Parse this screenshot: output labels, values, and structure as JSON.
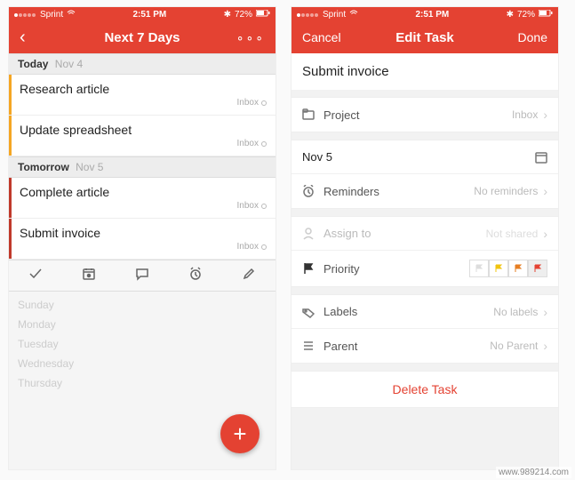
{
  "status": {
    "carrier": "Sprint",
    "time": "2:51 PM",
    "battery": "72%"
  },
  "left": {
    "title": "Next 7 Days",
    "sections": [
      {
        "label": "Today",
        "sub": "Nov 4",
        "tasks": [
          {
            "title": "Research article",
            "project": "Inbox",
            "color": "#f5a623"
          },
          {
            "title": "Update spreadsheet",
            "project": "Inbox",
            "color": "#f5a623"
          }
        ]
      },
      {
        "label": "Tomorrow",
        "sub": "Nov 5",
        "tasks": [
          {
            "title": "Complete article",
            "project": "Inbox",
            "color": "#c0392b"
          },
          {
            "title": "Submit invoice",
            "project": "Inbox",
            "color": "#c0392b"
          }
        ]
      }
    ],
    "faded_days": [
      {
        "label": "Sunday"
      },
      {
        "label": "Monday"
      },
      {
        "label": "Tuesday"
      },
      {
        "label": "Wednesday"
      },
      {
        "label": "Thursday"
      }
    ]
  },
  "right": {
    "nav_left": "Cancel",
    "title": "Edit Task",
    "nav_right": "Done",
    "task_title": "Submit invoice",
    "project_label": "Project",
    "project_value": "Inbox",
    "date_value": "Nov 5",
    "reminders_label": "Reminders",
    "reminders_value": "No reminders",
    "assign_label": "Assign to",
    "assign_value": "Not shared",
    "priority_label": "Priority",
    "priority_selected": 4,
    "labels_label": "Labels",
    "labels_value": "No labels",
    "parent_label": "Parent",
    "parent_value": "No Parent",
    "delete_label": "Delete Task"
  },
  "watermark": "www.989214.com"
}
